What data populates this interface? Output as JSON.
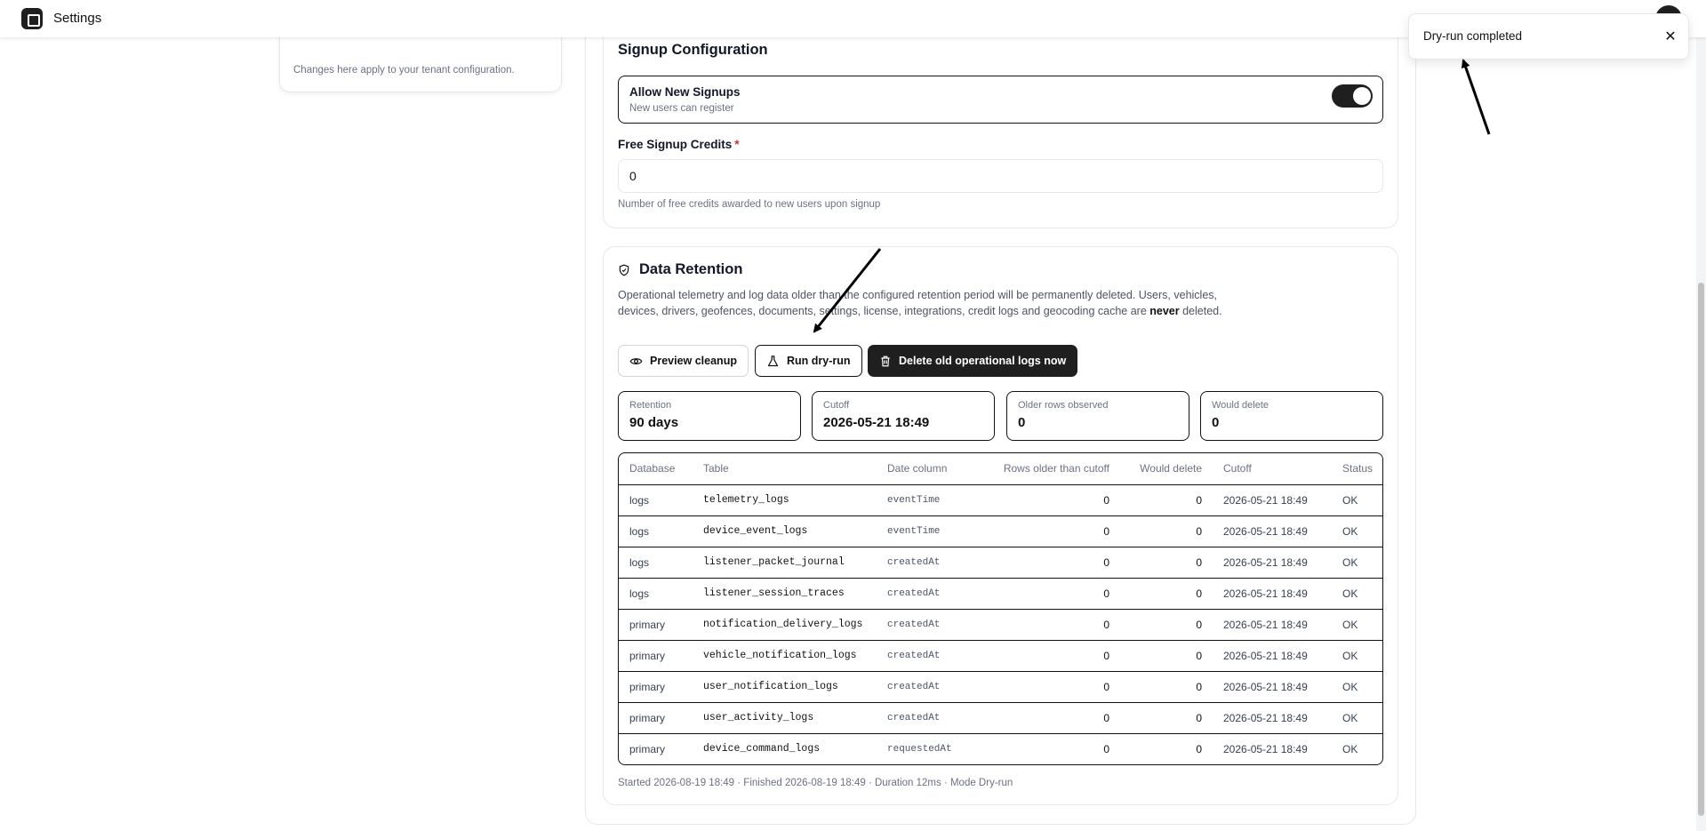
{
  "app": {
    "title": "Settings"
  },
  "sidebar_card": {
    "note": "Changes here apply to your tenant configuration."
  },
  "signup": {
    "heading": "Signup Configuration",
    "allow_title": "Allow New Signups",
    "allow_subtitle": "New users can register",
    "allow_enabled": true,
    "credits_label": "Free Signup Credits",
    "credits_required_mark": "*",
    "credits_value": "0",
    "credits_help": "Number of free credits awarded to new users upon signup"
  },
  "retention": {
    "heading": "Data Retention",
    "desc_1": "Operational telemetry and log data older than the configured retention period will be permanently deleted. Users, vehicles, devices, drivers, geofences, documents, settings, license, integrations, credit logs and geocoding cache are ",
    "desc_bold": "never",
    "desc_2": " deleted.",
    "buttons": {
      "preview": "Preview cleanup",
      "dry_run": "Run dry-run",
      "delete": "Delete old operational logs now"
    },
    "stats": [
      {
        "label": "Retention",
        "value": "90 days"
      },
      {
        "label": "Cutoff",
        "value": "2026-05-21 18:49"
      },
      {
        "label": "Older rows observed",
        "value": "0"
      },
      {
        "label": "Would delete",
        "value": "0"
      }
    ],
    "table": {
      "headers": [
        "Database",
        "Table",
        "Date column",
        "Rows older than cutoff",
        "Would delete",
        "Cutoff",
        "Status"
      ],
      "rows": [
        [
          "logs",
          "telemetry_logs",
          "eventTime",
          "0",
          "0",
          "2026-05-21 18:49",
          "OK"
        ],
        [
          "logs",
          "device_event_logs",
          "eventTime",
          "0",
          "0",
          "2026-05-21 18:49",
          "OK"
        ],
        [
          "logs",
          "listener_packet_journal",
          "createdAt",
          "0",
          "0",
          "2026-05-21 18:49",
          "OK"
        ],
        [
          "logs",
          "listener_session_traces",
          "createdAt",
          "0",
          "0",
          "2026-05-21 18:49",
          "OK"
        ],
        [
          "primary",
          "notification_delivery_logs",
          "createdAt",
          "0",
          "0",
          "2026-05-21 18:49",
          "OK"
        ],
        [
          "primary",
          "vehicle_notification_logs",
          "createdAt",
          "0",
          "0",
          "2026-05-21 18:49",
          "OK"
        ],
        [
          "primary",
          "user_notification_logs",
          "createdAt",
          "0",
          "0",
          "2026-05-21 18:49",
          "OK"
        ],
        [
          "primary",
          "user_activity_logs",
          "createdAt",
          "0",
          "0",
          "2026-05-21 18:49",
          "OK"
        ],
        [
          "primary",
          "device_command_logs",
          "requestedAt",
          "0",
          "0",
          "2026-05-21 18:49",
          "OK"
        ]
      ]
    },
    "summary": "Started 2026-08-19 18:49 · Finished 2026-08-19 18:49 · Duration 12ms · Mode Dry-run"
  },
  "toast": {
    "message": "Dry-run completed",
    "close_icon": "close-icon"
  },
  "icons": {
    "logo": "app-logo-icon",
    "shield": "shield-check-icon",
    "eye": "eye-icon",
    "flask": "flask-icon",
    "trash": "trash-icon"
  },
  "colors": {
    "dark": "#1f1f1f",
    "required": "#dc2626",
    "muted": "#6b7280"
  }
}
